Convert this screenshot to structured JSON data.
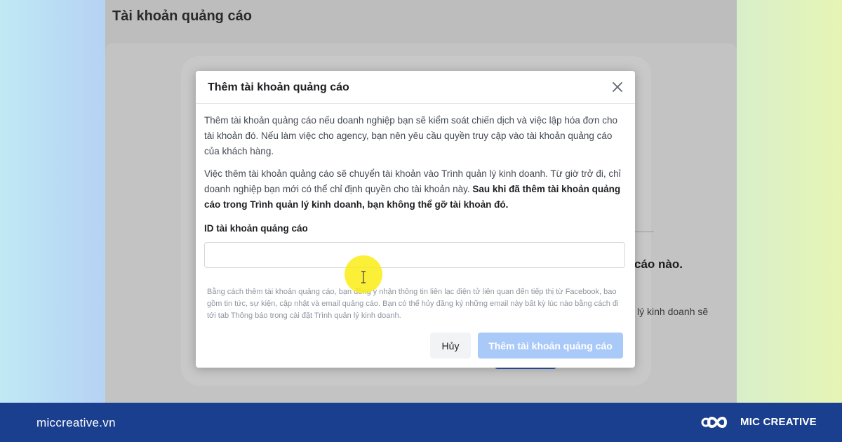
{
  "background_page": {
    "title": "Tài khoản quảng cáo",
    "partial_heading": "cáo nào.",
    "partial_text": "lý kinh doanh sẽ"
  },
  "modal": {
    "title": "Thêm tài khoản quảng cáo",
    "paragraph_1": "Thêm tài khoản quảng cáo nếu doanh nghiệp bạn sẽ kiểm soát chiến dịch và việc lập hóa đơn cho tài khoản đó. Nếu làm việc cho agency, bạn nên yêu cầu quyền truy cập vào tài khoản quảng cáo của khách hàng.",
    "paragraph_2_normal": "Việc thêm tài khoản quảng cáo sẽ chuyển tài khoản vào Trình quản lý kinh doanh. Từ giờ trở đi, chỉ doanh nghiệp bạn mới có thể chỉ định quyền cho tài khoản này. ",
    "paragraph_2_bold": "Sau khi đã thêm tài khoản quảng cáo trong Trình quản lý kinh doanh, bạn không thể gỡ tài khoản đó.",
    "field_label": "ID tài khoản quảng cáo",
    "field_value": "",
    "disclaimer": "Bằng cách thêm tài khoản quảng cáo, bạn đồng ý nhận thông tin liên lạc điện tử liên quan đến tiếp thị từ Facebook, bao gồm tin tức, sự kiện, cập nhật và email quảng cáo. Bạn có thể hủy đăng ký những email này bất kỳ lúc nào bằng cách đi tới tab Thông báo trong cài đặt Trình quản lý kinh doanh.",
    "cancel_label": "Hủy",
    "submit_label": "Thêm tài khoản quảng cáo"
  },
  "footer": {
    "url": "miccreative.vn",
    "brand": "MIC CREATIVE"
  },
  "icons": {
    "close": "close-icon",
    "text_cursor": "text-cursor-icon",
    "logo": "mic-creative-logo-icon"
  },
  "colors": {
    "footer_bg": "#1a3f8f",
    "primary_disabled": "#a9c9f8",
    "cursor_highlight": "#faec14"
  }
}
